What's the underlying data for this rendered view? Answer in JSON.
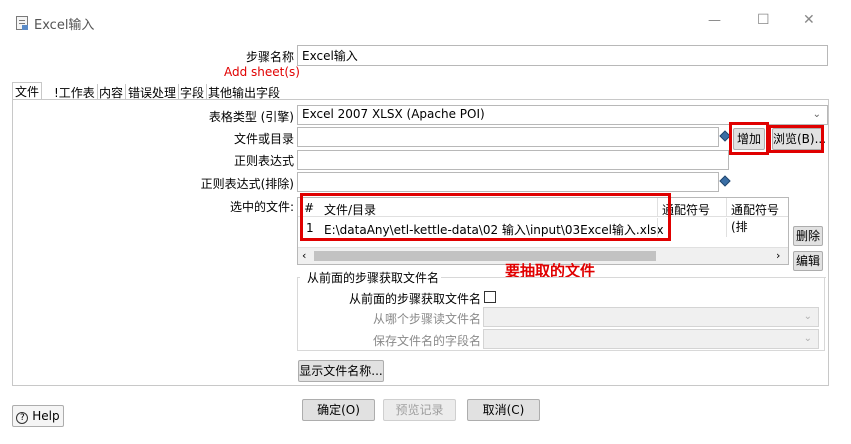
{
  "window": {
    "title": "Excel输入",
    "minimize": "—",
    "maximize": "☐",
    "close": "✕"
  },
  "step": {
    "name_label": "步骤名称",
    "name_value": "Excel输入",
    "add_sheet_link": "Add sheet(s)"
  },
  "tabs": [
    {
      "label": "文件"
    },
    {
      "label": "!工作表"
    },
    {
      "label": "内容"
    },
    {
      "label": "错误处理"
    },
    {
      "label": "字段"
    },
    {
      "label": "其他输出字段"
    }
  ],
  "form": {
    "sheet_type_label": "表格类型 (引擎)",
    "sheet_type_value": "Excel 2007 XLSX (Apache POI)",
    "file_or_dir_label": "文件或目录",
    "file_or_dir_value": "",
    "regex_label": "正则表达式",
    "regex_value": "",
    "regex_exclude_label": "正则表达式(排除)",
    "regex_exclude_value": "",
    "selected_files_label": "选中的文件:",
    "add_button": "增加",
    "browse_button": "浏览(B)...",
    "delete_button": "删除",
    "edit_button": "编辑"
  },
  "file_table": {
    "columns": [
      "#",
      "文件/目录",
      "通配符号",
      "通配符号(排"
    ],
    "rows": [
      [
        "1",
        "E:\\dataAny\\etl-kettle-data\\02 输入\\input\\03Excel输入.xlsx",
        "",
        ""
      ]
    ]
  },
  "annotation": {
    "text": "要抽取的文件",
    "color": "#e00000"
  },
  "prev_step_group": {
    "title": "从前面的步骤获取文件名",
    "checkbox_label": "从前面的步骤获取文件名",
    "checked": false,
    "read_from_label": "从哪个步骤读文件名",
    "read_from_value": "",
    "field_label": "保存文件名的字段名",
    "field_value": ""
  },
  "show_filenames_button": "显示文件名称...",
  "footer": {
    "help": "Help",
    "ok": "确定(O)",
    "preview": "预览记录",
    "cancel": "取消(C)"
  },
  "icons": {
    "app": "spoon-step-icon",
    "variable": "variable-diamond-icon",
    "help": "question-circle-icon"
  }
}
